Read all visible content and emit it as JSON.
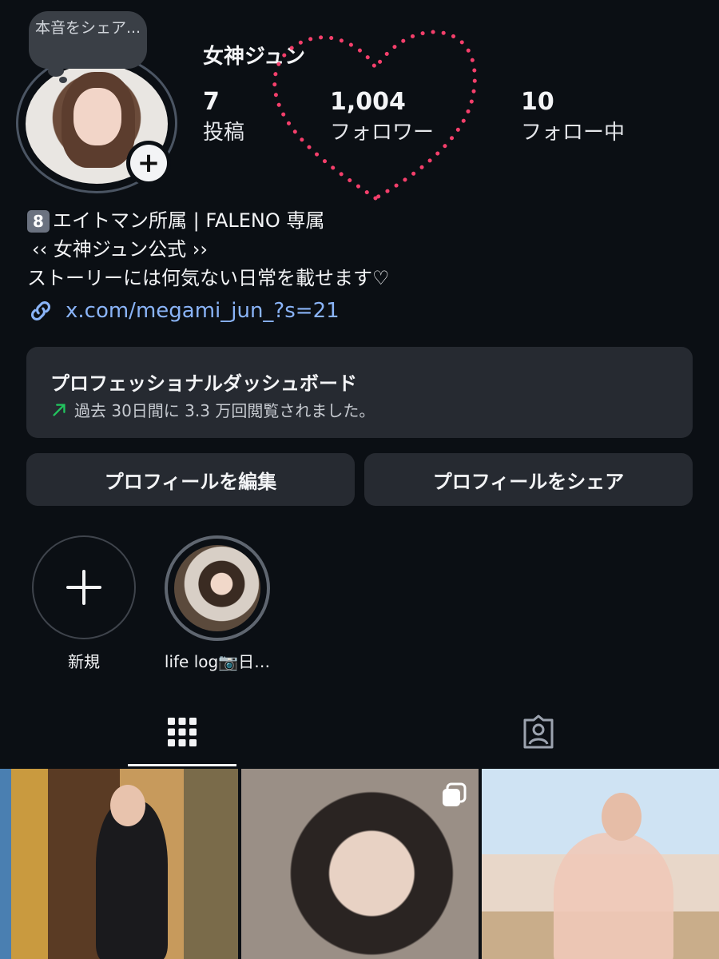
{
  "note": {
    "text": "本音をシェア..."
  },
  "profile": {
    "name": "女神ジュン"
  },
  "stats": [
    {
      "value": "7",
      "label": "投稿"
    },
    {
      "value": "1,004",
      "label": "フォロワー"
    },
    {
      "value": "10",
      "label": "フォロー中"
    }
  ],
  "bio": {
    "line1_badge": "8",
    "line1": "エイトマン所属 | FALENO 専属",
    "line2": "‹‹ 女神ジュン公式 ››",
    "line3": "ストーリーには何気ない日常を載せます♡",
    "link": "x.com/megami_jun_?s=21"
  },
  "dashboard": {
    "title": "プロフェッショナルダッシュボード",
    "subtitle": "過去 30日間に 3.3 万回閲覧されました。"
  },
  "buttons": {
    "edit": "プロフィールを編集",
    "share": "プロフィールをシェア"
  },
  "highlights": [
    {
      "label": "新規"
    },
    {
      "label": "life log📷日…"
    }
  ],
  "colors": {
    "background": "#0b0f14",
    "card": "#262a31",
    "link": "#8ab4f8",
    "trend": "#22c55e",
    "heart_dots": "#f43f6b"
  }
}
